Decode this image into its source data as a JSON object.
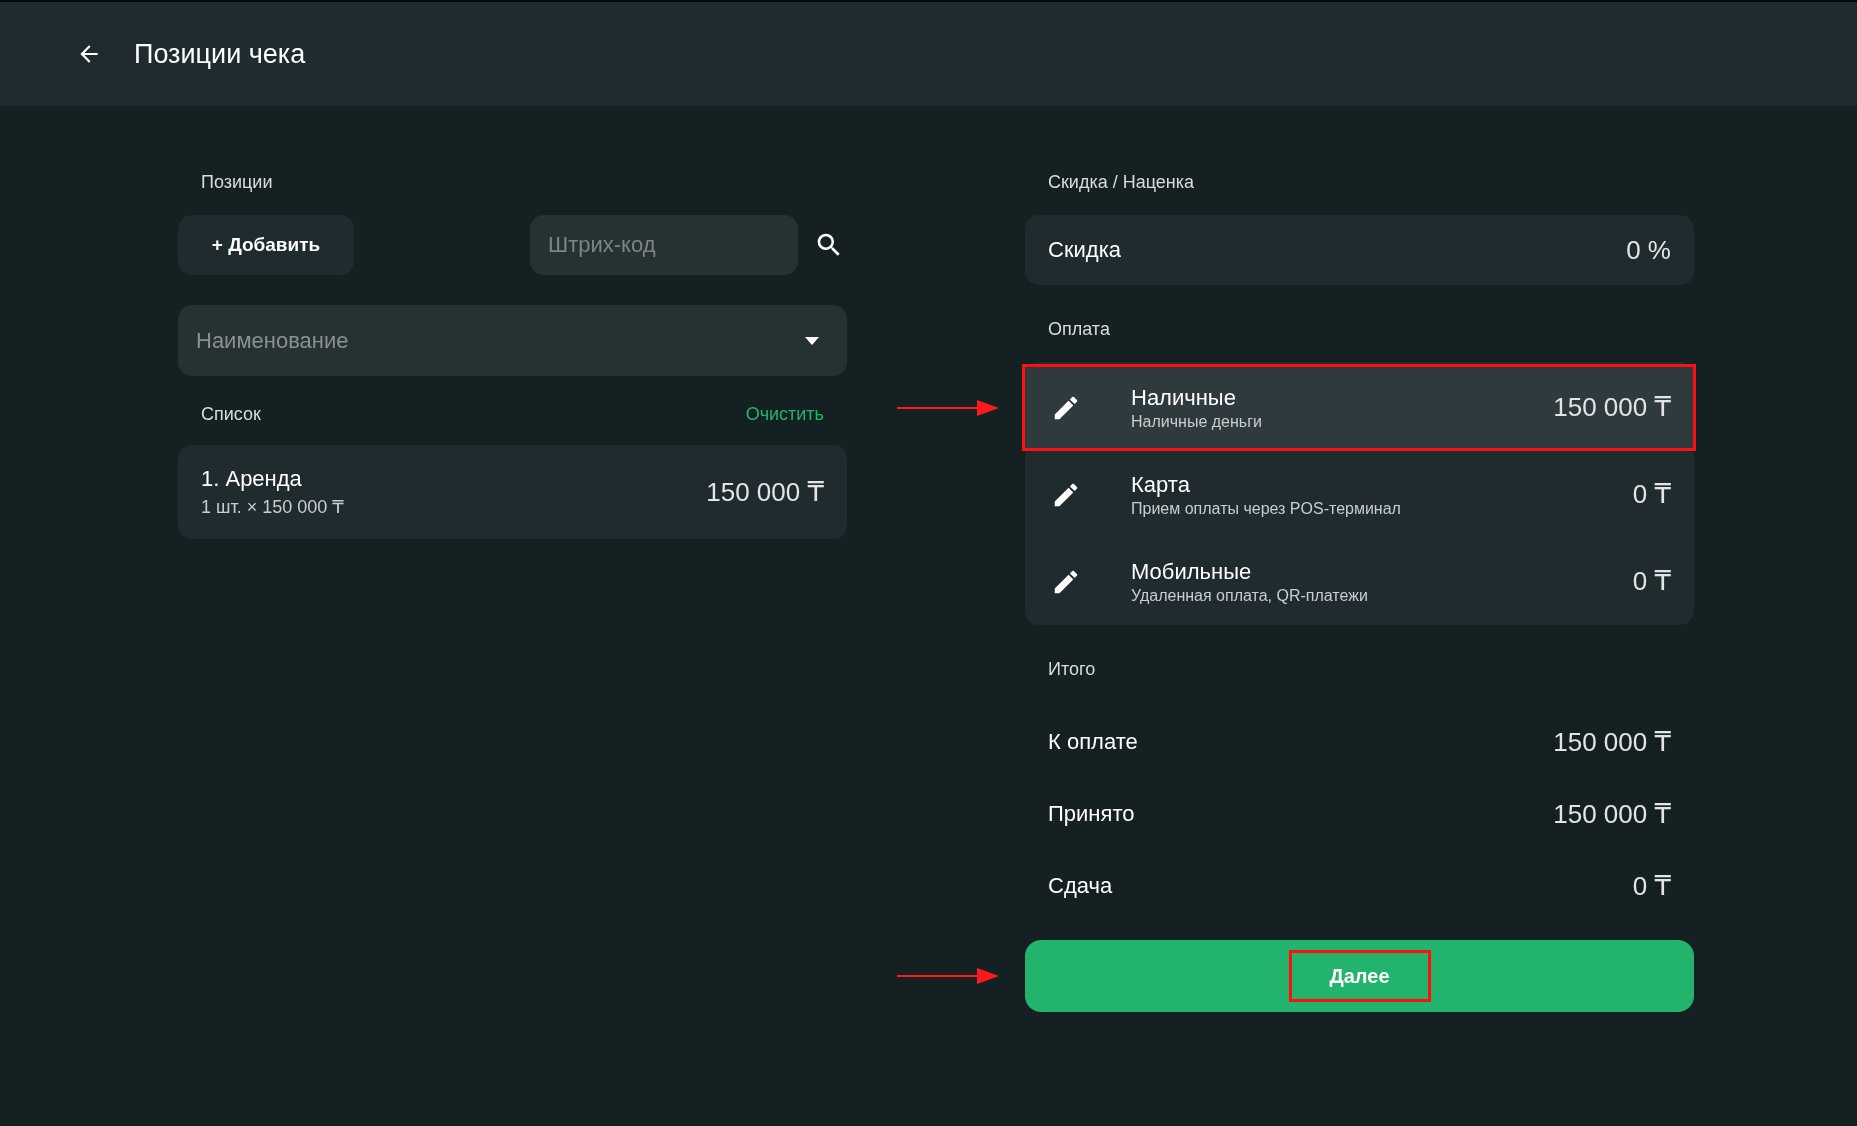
{
  "header": {
    "title": "Позиции чека"
  },
  "positions": {
    "label": "Позиции",
    "add_button": "+ Добавить",
    "barcode": {
      "placeholder": "Штрих-код"
    },
    "name_select": {
      "placeholder": "Наименование"
    }
  },
  "list": {
    "label": "Список",
    "clear_link": "Очистить",
    "items": [
      {
        "title": "1. Аренда",
        "detail": "1 шт. × 150 000 ₸",
        "amount": "150 000 ₸"
      }
    ]
  },
  "discount": {
    "label": "Скидка / Наценка",
    "name": "Скидка",
    "value": "0 %"
  },
  "payment": {
    "label": "Оплата",
    "methods": [
      {
        "name": "Наличные",
        "description": "Наличные деньги",
        "amount": "150 000 ₸",
        "selected": true,
        "highlighted": true
      },
      {
        "name": "Карта",
        "description": "Прием оплаты через POS-терминал",
        "amount": "0 ₸",
        "selected": false,
        "highlighted": false
      },
      {
        "name": "Мобильные",
        "description": "Удаленная оплата, QR-платежи",
        "amount": "0 ₸",
        "selected": false,
        "highlighted": false
      }
    ]
  },
  "totals": {
    "label": "Итого",
    "rows": [
      {
        "label": "К оплате",
        "value": "150 000 ₸"
      },
      {
        "label": "Принято",
        "value": "150 000 ₸"
      },
      {
        "label": "Сдача",
        "value": "0 ₸"
      }
    ]
  },
  "next_button": {
    "label": "Далее",
    "highlighted": true
  }
}
